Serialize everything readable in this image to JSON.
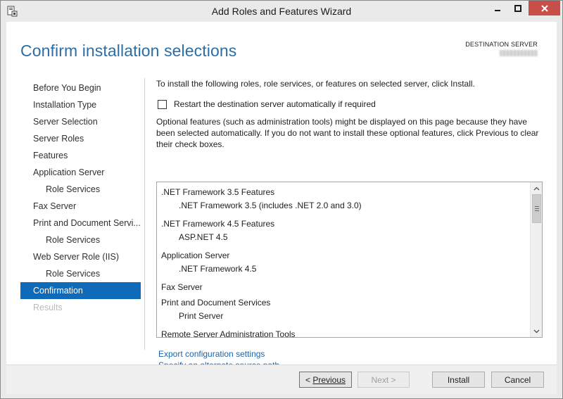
{
  "window": {
    "title": "Add Roles and Features Wizard"
  },
  "header": {
    "page_title": "Confirm installation selections",
    "destination_label": "DESTINATION SERVER"
  },
  "nav": {
    "items": [
      {
        "label": "Before You Begin"
      },
      {
        "label": "Installation Type"
      },
      {
        "label": "Server Selection"
      },
      {
        "label": "Server Roles"
      },
      {
        "label": "Features"
      },
      {
        "label": "Application Server"
      },
      {
        "label": "Role Services"
      },
      {
        "label": "Fax Server"
      },
      {
        "label": "Print and Document Servi..."
      },
      {
        "label": "Role Services"
      },
      {
        "label": "Web Server Role (IIS)"
      },
      {
        "label": "Role Services"
      },
      {
        "label": "Confirmation"
      },
      {
        "label": "Results"
      }
    ]
  },
  "main": {
    "intro": "To install the following roles, role services, or features on selected server, click Install.",
    "restart_label": "Restart the destination server automatically if required",
    "restart_checked": false,
    "optional_note": "Optional features (such as administration tools) might be displayed on this page because they have been selected automatically. If you do not want to install these optional features, click Previous to clear their check boxes.",
    "features": [
      {
        "name": ".NET Framework 3.5 Features",
        "sub": ".NET Framework 3.5 (includes .NET 2.0 and 3.0)"
      },
      {
        "name": ".NET Framework 4.5 Features",
        "sub": "ASP.NET 4.5"
      },
      {
        "name": "Application Server",
        "sub": ".NET Framework 4.5"
      },
      {
        "name": "Fax Server"
      },
      {
        "name": "Print and Document Services",
        "sub": "Print Server"
      },
      {
        "name": "Remote Server Administration Tools"
      }
    ],
    "export_link": "Export configuration settings",
    "alt_source_link": "Specify an alternate source path"
  },
  "footer": {
    "previous_prefix": "< ",
    "previous_label": "Previous",
    "next_label": "Next >",
    "install_label": "Install",
    "cancel_label": "Cancel"
  }
}
